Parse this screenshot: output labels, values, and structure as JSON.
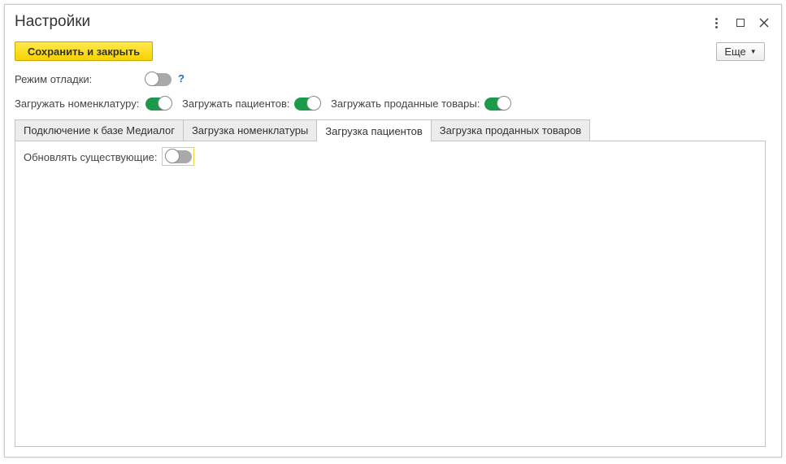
{
  "window": {
    "title": "Настройки"
  },
  "toolbar": {
    "save_close_label": "Сохранить и закрыть",
    "more_label": "Еще"
  },
  "settings": {
    "debug_mode_label": "Режим отладки:",
    "debug_mode_on": false,
    "help_glyph": "?",
    "load_nomenclature_label": "Загружать номенклатуру:",
    "load_nomenclature_on": true,
    "load_patients_label": "Загружать пациентов:",
    "load_patients_on": true,
    "load_sold_goods_label": "Загружать проданные товары:",
    "load_sold_goods_on": true
  },
  "tabs": [
    {
      "label": "Подключение к базе Медиалог",
      "active": false
    },
    {
      "label": "Загрузка номенклатуры",
      "active": false
    },
    {
      "label": "Загрузка пациентов",
      "active": true
    },
    {
      "label": "Загрузка проданных товаров",
      "active": false
    }
  ],
  "panel": {
    "update_existing_label": "Обновлять существующие:",
    "update_existing_on": false
  },
  "colors": {
    "accent_yellow": "#f7d300",
    "toggle_on": "#1b9a4c",
    "toggle_off": "#a9a9a9",
    "help_link": "#1a6fc4"
  },
  "icons": [
    "kebab-menu-icon",
    "maximize-icon",
    "close-icon",
    "caret-down-icon"
  ]
}
